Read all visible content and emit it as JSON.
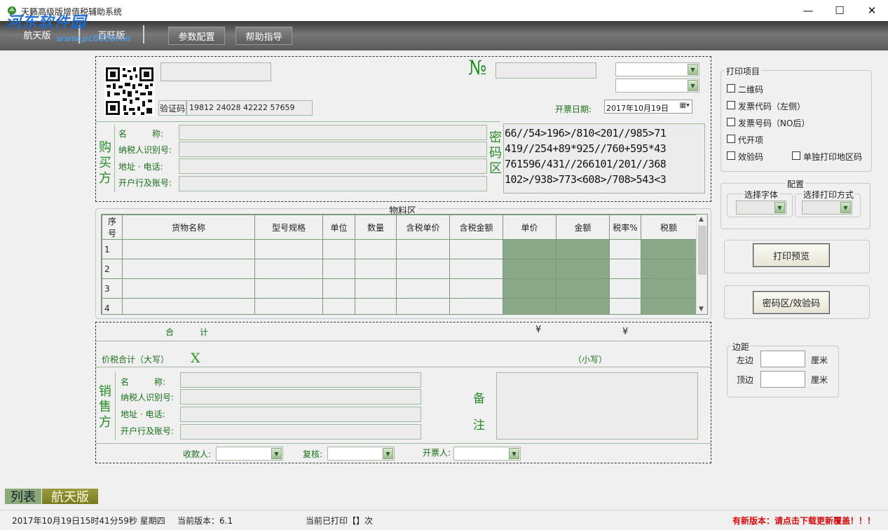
{
  "window": {
    "title": "天籁高级版增值税辅助系统",
    "minimize_glyph": "—",
    "maximize_glyph": "☐",
    "close_glyph": "✕"
  },
  "watermark": {
    "text": "河东软件园",
    "sub": "www.pc0359.cn"
  },
  "toolbar": {
    "tab_hangtian": "航天版",
    "tab_baiwang": "百旺版",
    "btn_params": "参数配置",
    "btn_help": "帮助指导"
  },
  "invoice": {
    "no_symbol": "№",
    "verify_label": "验证码",
    "verify_code": "19812 24028 42222 57659",
    "issue_date_label": "开票日期:",
    "issue_date": "2017年10月19日",
    "buyer_side": "购买方",
    "buyer_name_label": "名　　　称:",
    "buyer_taxid_label": "纳税人识别号:",
    "buyer_addr_label": "地址 · 电话:",
    "buyer_bank_label": "开户行及账号:",
    "cipher_side": "密码区",
    "cipher_lines": [
      "66//54>196>/810<201//985>71",
      "419//254+89*925//760+595*43",
      "761596/431//266101/201//368",
      "102>/938>773<608>/708>543<3"
    ],
    "goods_section_title": "物料区",
    "columns": [
      "序号",
      "货物名称",
      "型号规格",
      "单位",
      "数量",
      "含税单价",
      "含税金额",
      "单价",
      "金额",
      "税率%",
      "税额"
    ],
    "rows": [
      {
        "no": "1"
      },
      {
        "no": "2"
      },
      {
        "no": "3"
      },
      {
        "no": "4"
      }
    ],
    "total_label_a": "合",
    "total_label_b": "计",
    "yen1": "¥",
    "yen2": "¥",
    "price_tax_total_label": "价税合计（大写）",
    "big_x": "X",
    "small_label": "（小写）",
    "seller_side": "销售方",
    "seller_name_label": "名　　　称:",
    "seller_taxid_label": "纳税人识别号:",
    "seller_addr_label": "地址 · 电话:",
    "seller_bank_label": "开户行及账号:",
    "remark_a": "备",
    "remark_b": "注",
    "payee_label": "收款人:",
    "reviewer_label": "复核:",
    "drawer_label": "开票人:"
  },
  "print_items": {
    "title": "打印项目",
    "qr": "二维码",
    "code_left": "发票代码（左侧）",
    "number_after": "发票号码（NO后）",
    "daikai": "代开项",
    "verify": "效验码",
    "single_region": "单独打印地区码"
  },
  "config": {
    "title": "配置",
    "font_label": "选择字体",
    "method_label": "选择打印方式"
  },
  "buttons": {
    "print_preview": "打印预览",
    "cipher_verify": "密码区/效验码"
  },
  "margin": {
    "title": "边距",
    "left_label": "左边",
    "top_label": "顶边",
    "unit": "厘米",
    "left_value": "",
    "top_value": ""
  },
  "bottom_tabs": {
    "list": "列表",
    "hangtian": "航天版"
  },
  "status": {
    "datetime": "2017年10月19日15时41分59秒  星期四",
    "version": "当前版本：6.1",
    "printed": "当前已打印【】次",
    "update": "有新版本：请点击下载更新覆盖！！！"
  },
  "colors": {
    "accent_green": "#1b6e1b",
    "dark_cell": "#8ba888",
    "update_red": "#d01010"
  }
}
